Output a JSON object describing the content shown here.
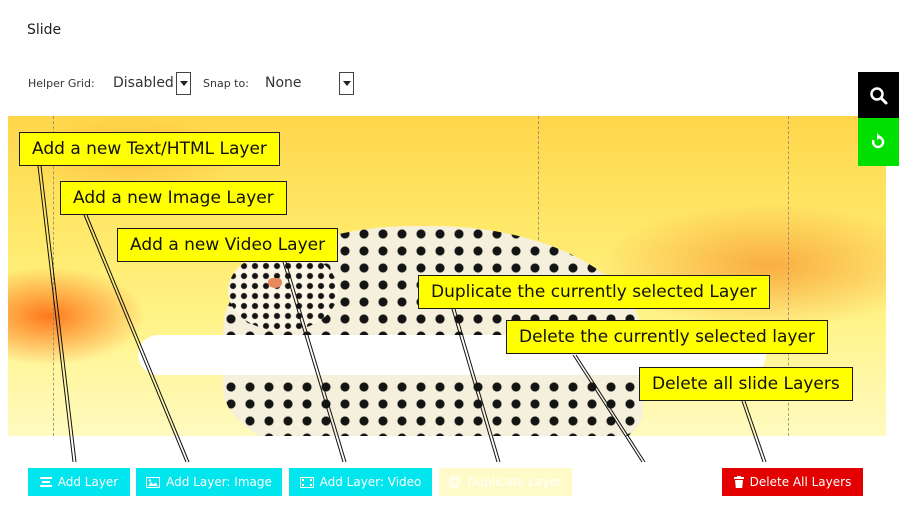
{
  "slide": {
    "title": "Slide"
  },
  "helper": {
    "grid_label": "Helper Grid:",
    "grid_value": "Disabled",
    "snap_label": "Snap to:",
    "snap_value": "None"
  },
  "tooltips": {
    "text_layer": "Add a new Text/HTML Layer",
    "image_layer": "Add a new Image Layer",
    "video_layer": "Add a new Video Layer",
    "duplicate_layer": "Duplicate the currently selected Layer",
    "delete_layer": "Delete the currently selected layer",
    "delete_all": "Delete all slide Layers"
  },
  "toolbar": {
    "add_layer": "Add Layer",
    "add_image": "Add Layer: Image",
    "add_video": "Add Layer: Video",
    "duplicate": "Duplicate Layer",
    "delete_all": "Delete All Layers"
  },
  "side": {
    "search_icon": "search-icon",
    "refresh_icon": "refresh-icon"
  },
  "colors": {
    "tooltip_bg": "#ffff00",
    "button_cyan": "#00e5ee",
    "button_red": "#e20000",
    "side_black": "#000000",
    "side_green": "#00e000"
  }
}
